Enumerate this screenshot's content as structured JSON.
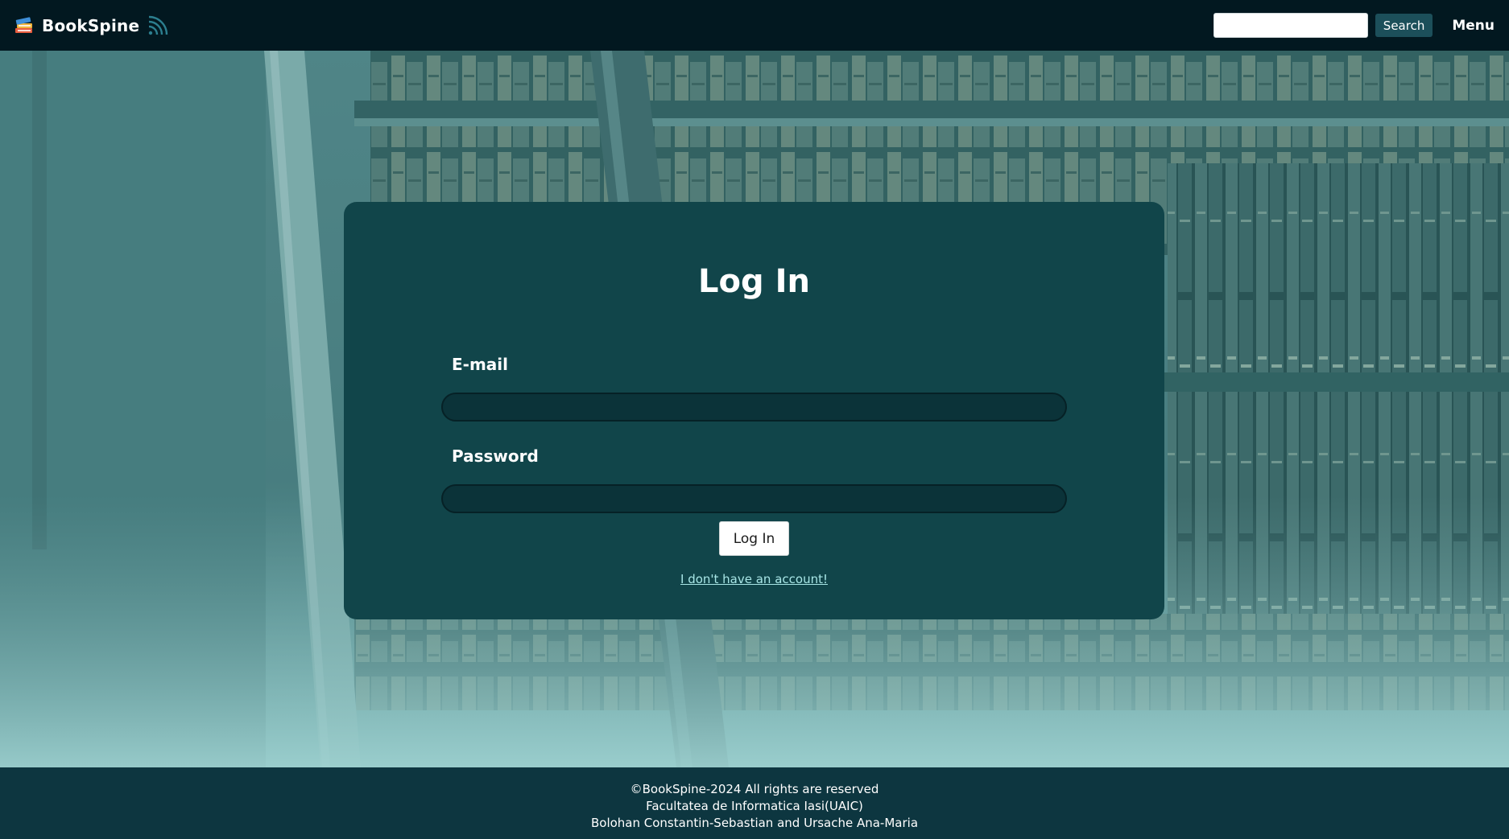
{
  "header": {
    "brand_name": "BookSpine",
    "logo_icon": "stacked-books-icon",
    "feed_icon": "rss-feed-icon",
    "search_placeholder": "",
    "search_value": "",
    "search_label": "Search",
    "menu_label": "Menu"
  },
  "login": {
    "title": "Log In",
    "email_label": "E-mail",
    "email_value": "",
    "password_label": "Password",
    "password_value": "",
    "submit_label": "Log In",
    "signup_link": "I don't have an account!"
  },
  "footer": {
    "line1": "©BookSpine-2024 All rights are reserved",
    "line2": "Facultatea de Informatica Iasi(UAIC)",
    "line3": "Bolohan Constantin-Sebastian and Ursache Ana-Maria"
  },
  "colors": {
    "header_bg": "#021820",
    "card_bg": "#11454a",
    "input_bg": "#0b3339",
    "footer_bg": "#0d3640",
    "link": "#a8e6e6",
    "search_button_bg": "#1c4f5a"
  }
}
